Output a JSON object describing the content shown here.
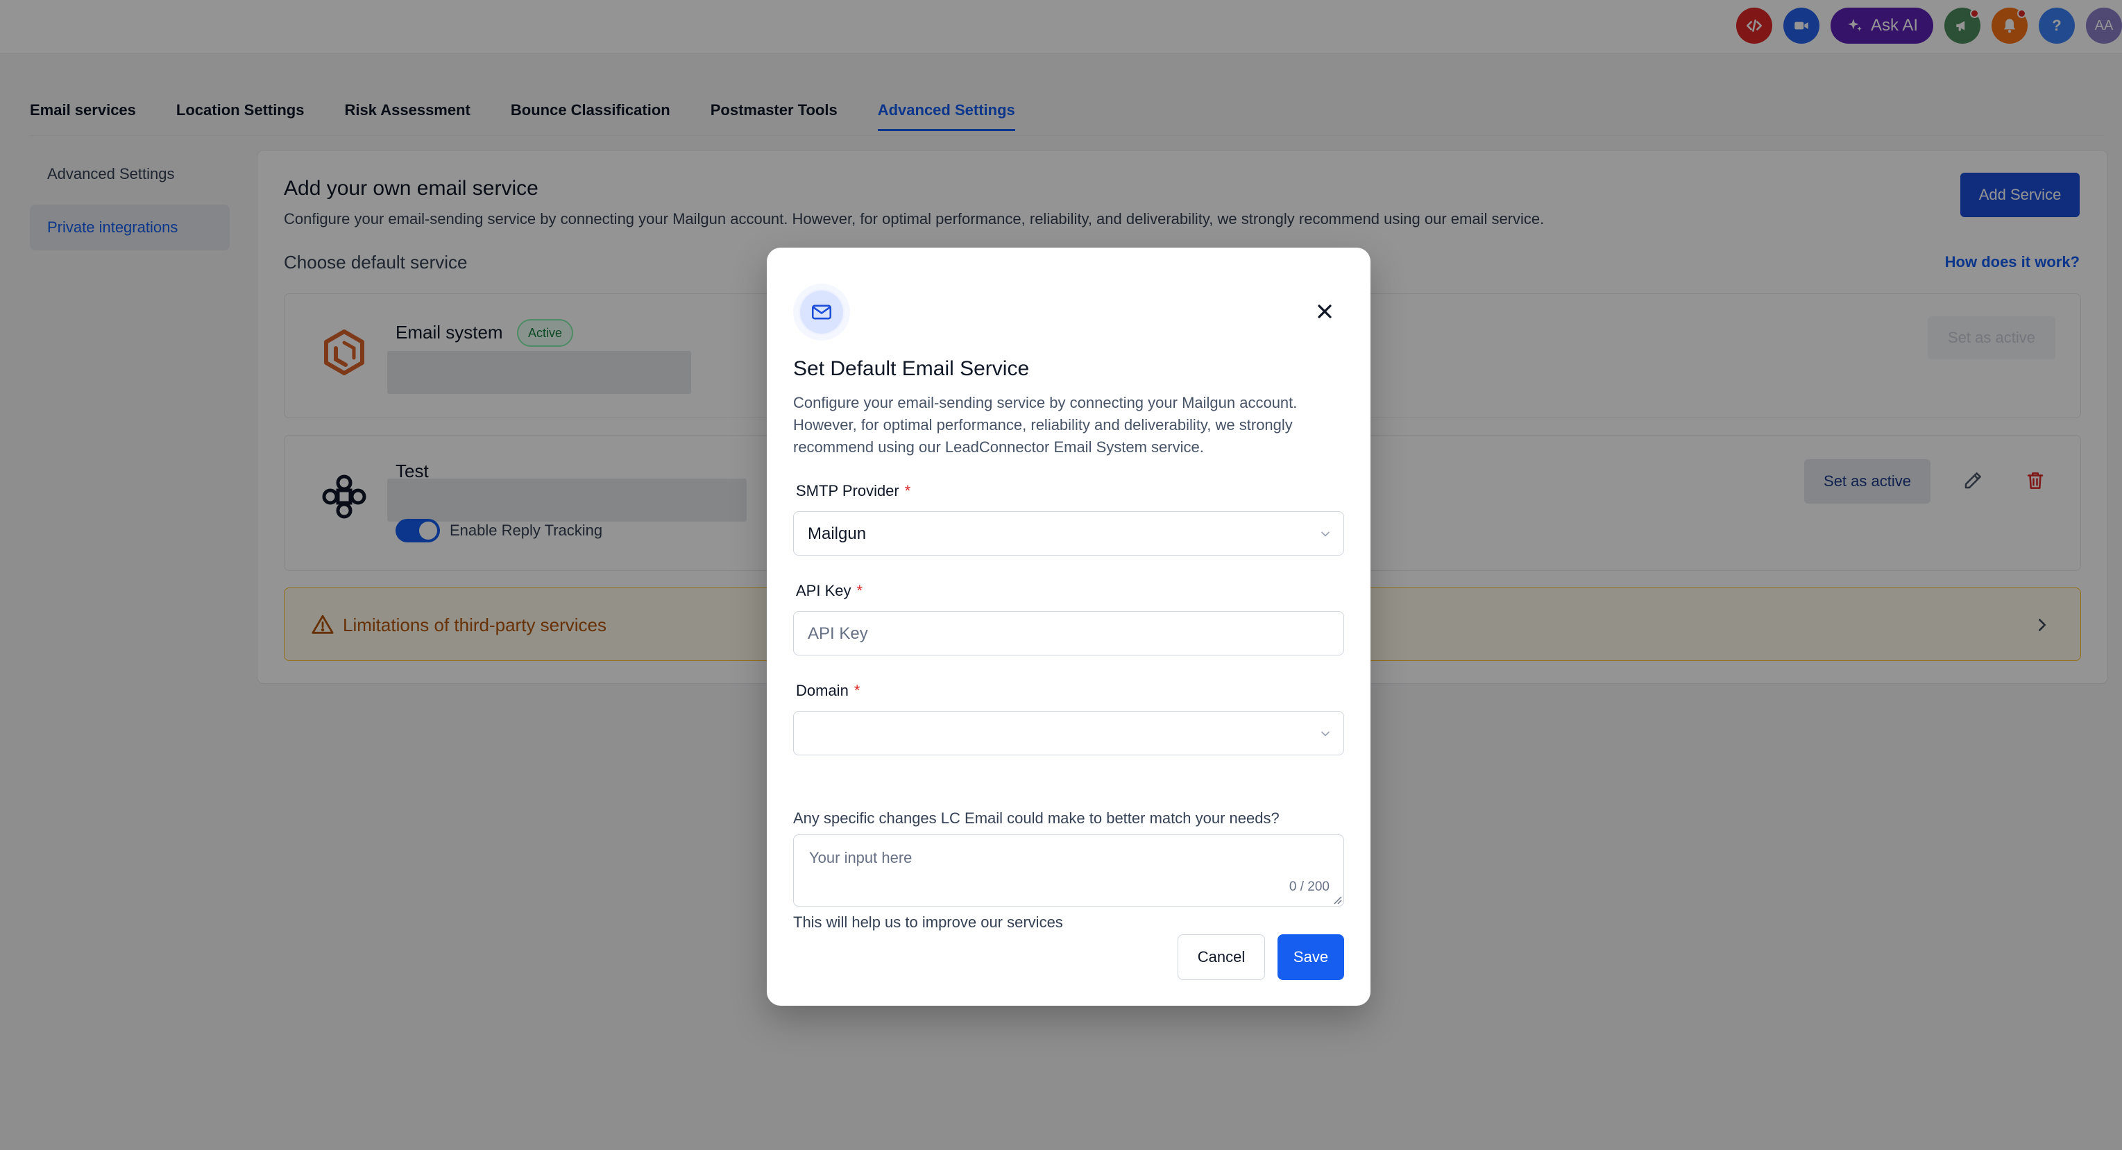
{
  "topbar": {
    "icons": [
      {
        "name": "code-icon",
        "color": "#dc2626"
      },
      {
        "name": "video-icon",
        "color": "#2563eb"
      },
      {
        "name": "megaphone-icon",
        "color": "#4d8a5c"
      },
      {
        "name": "bell-icon",
        "color": "#f97316"
      },
      {
        "name": "help-icon",
        "color": "#3b82f6"
      }
    ],
    "ask_ai_label": "Ask AI",
    "help_label": "?",
    "avatar_initials": "AA"
  },
  "tabs": [
    {
      "label": "Email services"
    },
    {
      "label": "Location Settings"
    },
    {
      "label": "Risk Assessment"
    },
    {
      "label": "Bounce Classification"
    },
    {
      "label": "Postmaster Tools"
    },
    {
      "label": "Advanced Settings",
      "active": true
    }
  ],
  "sidebar": {
    "items": [
      {
        "label": "Advanced Settings"
      },
      {
        "label": "Private integrations",
        "active": true
      }
    ]
  },
  "main": {
    "title": "Add your own email service",
    "description": "Configure your email-sending service by connecting your Mailgun account. However, for optimal performance, reliability, and deliverability, we strongly recommend using our email service.",
    "add_service_label": "Add Service",
    "choose_default_label": "Choose default service",
    "how_link_label": "How does it work?",
    "services": [
      {
        "name": "Email system",
        "badge": "Active",
        "action_label": "Set as active"
      },
      {
        "name": "Test",
        "toggle_label": "Enable Reply Tracking",
        "toggle_on": true,
        "action_label": "Set as active"
      }
    ],
    "limitations_label": "Limitations of third-party services"
  },
  "modal": {
    "title": "Set Default Email Service",
    "description": "Configure your email-sending service by connecting your Mailgun account. However, for optimal performance, reliability and deliverability, we strongly recommend using our LeadConnector Email System service.",
    "smtp_label": "SMTP Provider",
    "smtp_value": "Mailgun",
    "api_key_label": "API Key",
    "api_key_placeholder": "API Key",
    "domain_label": "Domain",
    "domain_value": "",
    "required_mark": "*",
    "question": "Any specific changes LC Email could make to better match your needs?",
    "textarea_placeholder": "Your input here",
    "counter": "0 / 200",
    "help_text": "This will help us to improve our services",
    "cancel_label": "Cancel",
    "save_label": "Save"
  },
  "colors": {
    "primary": "#155eef",
    "overlay": "rgba(0,0,0,0.42)",
    "warning_text": "#b45309",
    "active_badge": "#15803d",
    "danger": "#dc2626"
  }
}
